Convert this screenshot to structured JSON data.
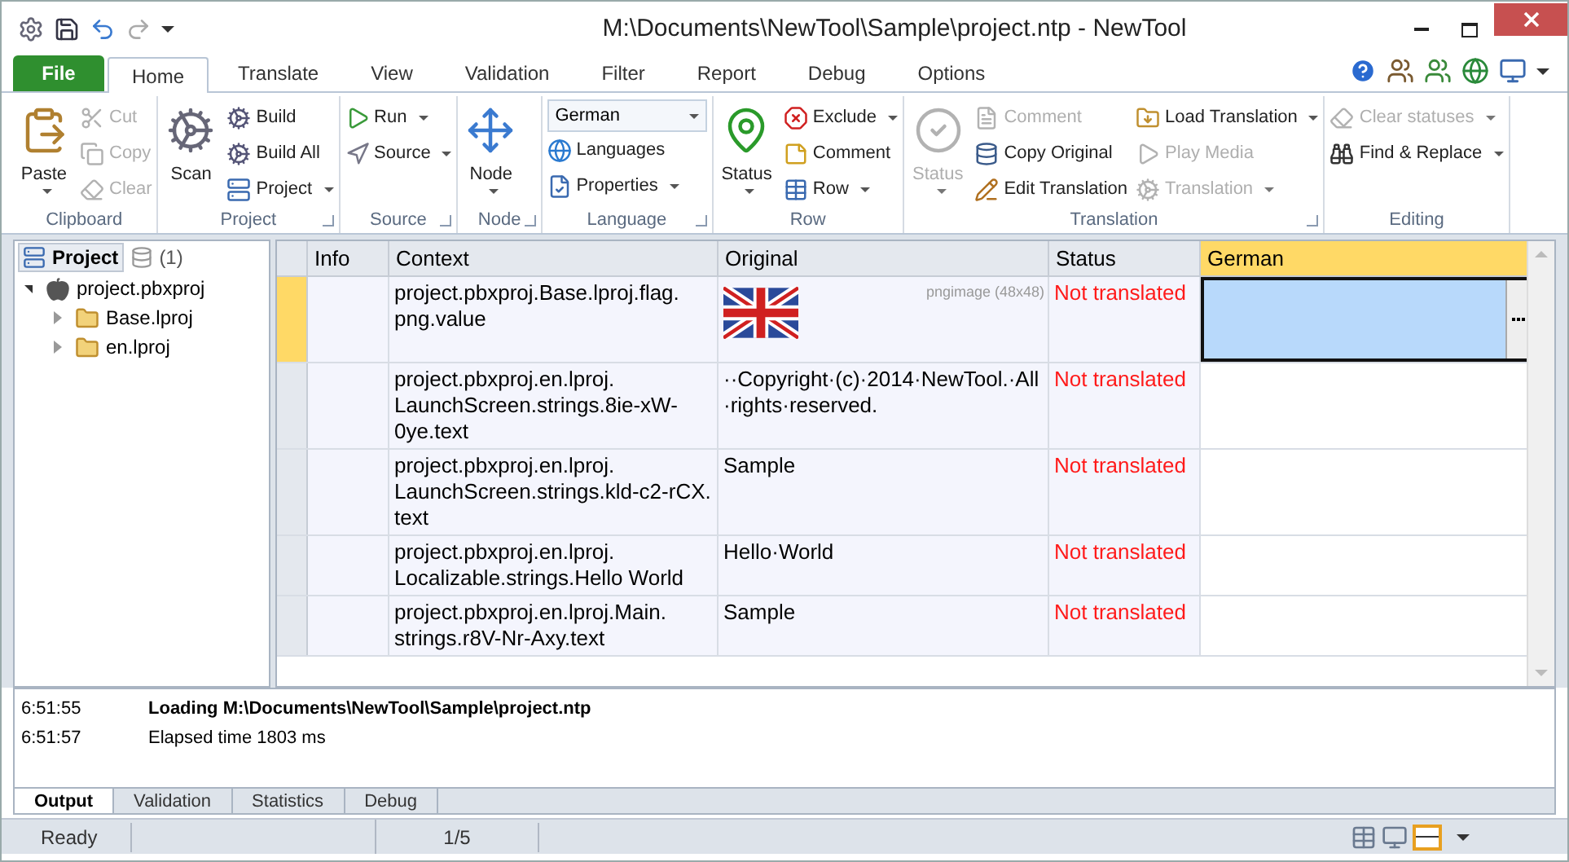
{
  "window": {
    "title": "M:\\Documents\\NewTool\\Sample\\project.ntp - NewTool"
  },
  "tabs": [
    {
      "label": "File",
      "kind": "file",
      "selected": false
    },
    {
      "label": "Home",
      "kind": "tab",
      "selected": true
    },
    {
      "label": "Translate",
      "kind": "tab",
      "selected": false
    },
    {
      "label": "View",
      "kind": "tab",
      "selected": false
    },
    {
      "label": "Validation",
      "kind": "tab",
      "selected": false
    },
    {
      "label": "Filter",
      "kind": "tab",
      "selected": false
    },
    {
      "label": "Report",
      "kind": "tab",
      "selected": false
    },
    {
      "label": "Debug",
      "kind": "tab",
      "selected": false
    },
    {
      "label": "Options",
      "kind": "tab",
      "selected": false
    }
  ],
  "ribbon": {
    "groups": [
      {
        "label": "Clipboard",
        "launcher": false,
        "items": [
          {
            "label": "Paste",
            "kind": "large",
            "dropdown": true,
            "disabled": false
          },
          {
            "label": "Cut",
            "kind": "small",
            "dropdown": false,
            "disabled": true
          },
          {
            "label": "Copy",
            "kind": "small",
            "dropdown": false,
            "disabled": true
          },
          {
            "label": "Clear",
            "kind": "small",
            "dropdown": false,
            "disabled": true
          }
        ]
      },
      {
        "label": "Project",
        "launcher": true,
        "items": [
          {
            "label": "Scan",
            "kind": "large",
            "dropdown": false,
            "disabled": false
          },
          {
            "label": "Build",
            "kind": "small",
            "dropdown": false,
            "disabled": false
          },
          {
            "label": "Build All",
            "kind": "small",
            "dropdown": false,
            "disabled": false
          },
          {
            "label": "Project",
            "kind": "small",
            "dropdown": true,
            "disabled": false
          }
        ]
      },
      {
        "label": "Source",
        "launcher": true,
        "items": [
          {
            "label": "Run",
            "kind": "small",
            "dropdown": true,
            "disabled": false
          },
          {
            "label": "Source",
            "kind": "small",
            "dropdown": true,
            "disabled": false
          }
        ]
      },
      {
        "label": "Node",
        "launcher": true,
        "items": [
          {
            "label": "Node",
            "kind": "large",
            "dropdown": true,
            "disabled": false
          }
        ]
      },
      {
        "label": "Language",
        "launcher": true,
        "items": [
          {
            "label": "German",
            "kind": "combo",
            "dropdown": true,
            "disabled": false
          },
          {
            "label": "Languages",
            "kind": "small",
            "dropdown": false,
            "disabled": false
          },
          {
            "label": "Properties",
            "kind": "small",
            "dropdown": true,
            "disabled": false
          }
        ]
      },
      {
        "label": "Row",
        "launcher": false,
        "items": [
          {
            "label": "Status",
            "kind": "large",
            "dropdown": true,
            "disabled": false
          },
          {
            "label": "Exclude",
            "kind": "small",
            "dropdown": true,
            "disabled": false
          },
          {
            "label": "Comment",
            "kind": "small",
            "dropdown": false,
            "disabled": false
          },
          {
            "label": "Row",
            "kind": "small",
            "dropdown": true,
            "disabled": false
          }
        ]
      },
      {
        "label": "Translation",
        "launcher": true,
        "items": [
          {
            "label": "Status",
            "kind": "large",
            "dropdown": true,
            "disabled": true
          },
          {
            "label": "Comment",
            "kind": "small",
            "dropdown": false,
            "disabled": true
          },
          {
            "label": "Copy Original",
            "kind": "small",
            "dropdown": false,
            "disabled": false
          },
          {
            "label": "Edit Translation",
            "kind": "small",
            "dropdown": false,
            "disabled": false
          },
          {
            "label": "Load Translation",
            "kind": "small",
            "dropdown": true,
            "disabled": false
          },
          {
            "label": "Play Media",
            "kind": "small",
            "dropdown": false,
            "disabled": true
          },
          {
            "label": "Translation",
            "kind": "small",
            "dropdown": true,
            "disabled": true
          }
        ]
      },
      {
        "label": "Editing",
        "launcher": false,
        "items": [
          {
            "label": "Clear statuses",
            "kind": "small",
            "dropdown": true,
            "disabled": true
          },
          {
            "label": "Find & Replace",
            "kind": "small",
            "dropdown": true,
            "disabled": false
          }
        ]
      }
    ]
  },
  "project_panel": {
    "tabs": [
      {
        "label": "Project",
        "selected": true
      },
      {
        "label": "(1)",
        "selected": false
      }
    ],
    "tree": [
      {
        "label": "project.pbxproj",
        "expanded": true,
        "children": [
          {
            "label": "Base.lproj",
            "expanded": false
          },
          {
            "label": "en.lproj",
            "expanded": false
          }
        ]
      }
    ]
  },
  "grid": {
    "columns": [
      {
        "label": "Info",
        "selected": false
      },
      {
        "label": "Context",
        "selected": false
      },
      {
        "label": "Original",
        "selected": false
      },
      {
        "label": "Status",
        "selected": false
      },
      {
        "label": "German",
        "selected": true
      }
    ],
    "rows": [
      {
        "selected": true,
        "context": "project.pbxproj.Base.lproj.flag.png.value",
        "original": {
          "kind": "image",
          "note": "pngimage (48x48)"
        },
        "status": "Not translated"
      },
      {
        "selected": false,
        "context": "project.pbxproj.en.lproj.LaunchScreen.strings.8ie-xW-0ye.text",
        "original": {
          "kind": "text",
          "text": "··Copyright·(c)·2014·NewTool.·All·rights·reserved."
        },
        "status": "Not translated"
      },
      {
        "selected": false,
        "context": "project.pbxproj.en.lproj.LaunchScreen.strings.kld-c2-rCX.text",
        "original": {
          "kind": "text",
          "text": "Sample"
        },
        "status": "Not translated"
      },
      {
        "selected": false,
        "context": "project.pbxproj.en.lproj.Localizable.strings.Hello World",
        "original": {
          "kind": "text",
          "text": "Hello·World"
        },
        "status": "Not translated"
      },
      {
        "selected": false,
        "context": "project.pbxproj.en.lproj.Main.strings.r8V-Nr-Axy.text",
        "original": {
          "kind": "text",
          "text": "Sample"
        },
        "status": "Not translated"
      }
    ]
  },
  "output": {
    "log": [
      {
        "time": "6:51:55",
        "message": "Loading M:\\Documents\\NewTool\\Sample\\project.ntp",
        "bold": true
      },
      {
        "time": "6:51:57",
        "message": "Elapsed time 1803 ms",
        "bold": false
      }
    ],
    "tabs": [
      {
        "label": "Output",
        "selected": true
      },
      {
        "label": "Validation",
        "selected": false
      },
      {
        "label": "Statistics",
        "selected": false
      },
      {
        "label": "Debug",
        "selected": false
      }
    ]
  },
  "status_bar": {
    "state": "Ready",
    "position": "1/5"
  }
}
